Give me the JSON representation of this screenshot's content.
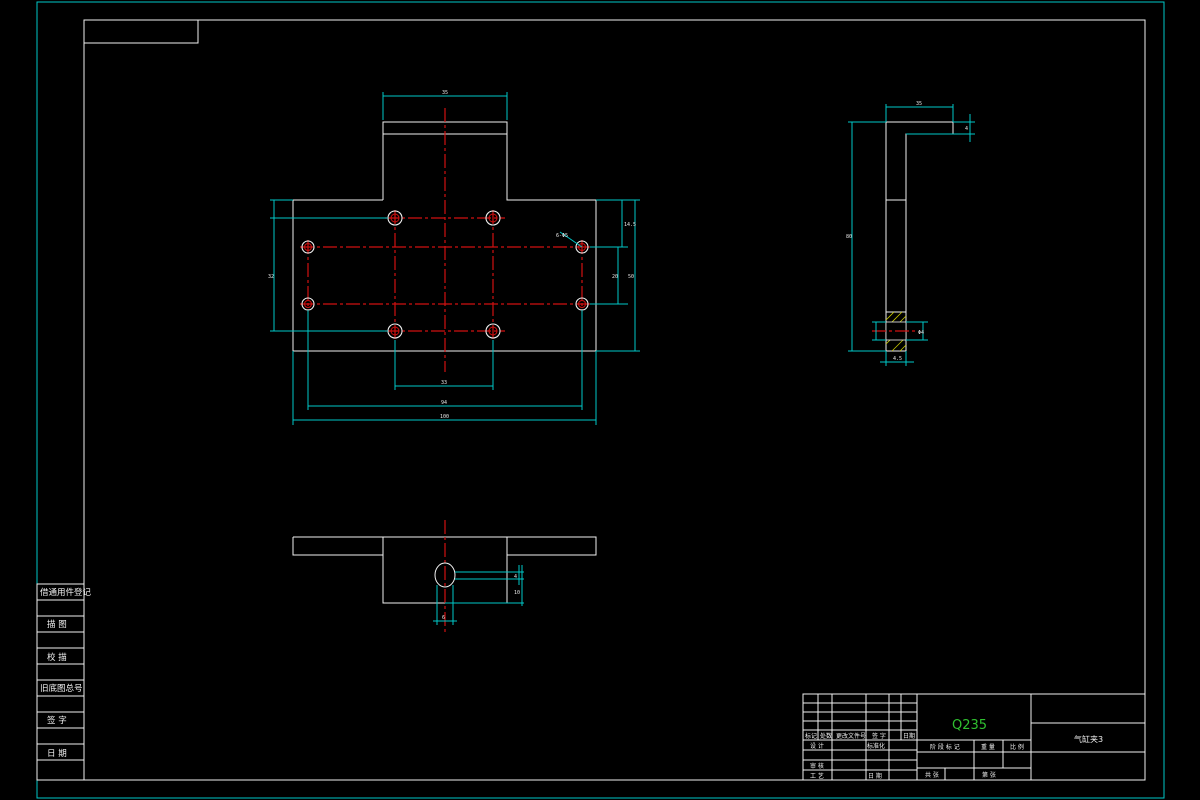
{
  "side_labels": [
    "借通用件登记",
    "描 图",
    "校 描",
    "旧底图总号",
    "签 字",
    "日 期"
  ],
  "title_block": {
    "material": "Q235",
    "drawing_name": "气缸夹3",
    "row_labels": [
      "标记",
      "处数",
      "更改文件号",
      "签 字",
      "日期"
    ],
    "design_label": "设 计",
    "standardize_label": "标准化",
    "review_label": "审 核",
    "process_label": "工 艺",
    "date_label": "日 期",
    "stage_label": "阶 段 标 记",
    "weight_label": "重 量",
    "scale_label": "比 例",
    "sheets_label": "共 张",
    "sheet_label": "第 张"
  },
  "dimensions": {
    "top_width": "35",
    "total_width": "100",
    "hole_span_outer": "94",
    "hole_span_inner": "33",
    "left_height": "32",
    "right_height": "50",
    "right_top": "14.5",
    "right_mid": "20",
    "hole_note": "6-Φ5",
    "side_top": "35",
    "side_thick": "4",
    "side_height": "80",
    "side_slot": "Φ4",
    "side_bottom": "4.5",
    "front_slot_w": "4",
    "front_slot_h": "10",
    "front_slot_d": "6"
  }
}
